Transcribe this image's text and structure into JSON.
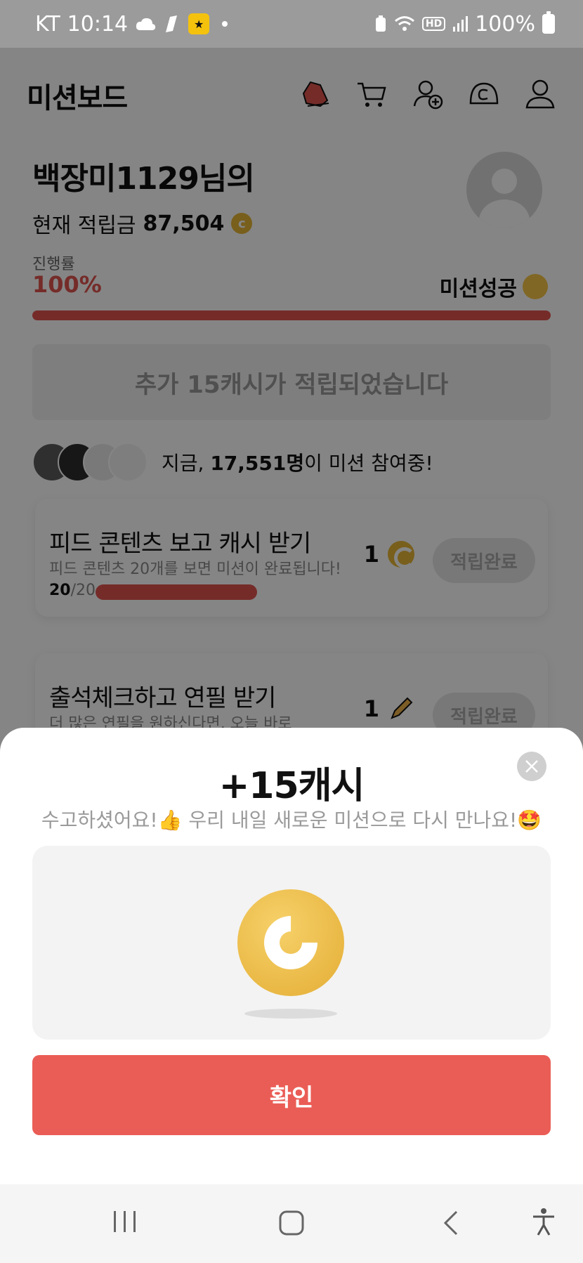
{
  "status_bar": {
    "carrier": "KT",
    "time": "10:14",
    "hd_label": "HD",
    "battery": "100%"
  },
  "header": {
    "title": "미션보드",
    "icons": [
      "shoe-icon",
      "cart-icon",
      "add-friend-icon",
      "cash-icon",
      "profile-icon"
    ]
  },
  "user": {
    "name": "백장미1129님의",
    "balance_label": "현재 적립금",
    "balance": "87,504",
    "coin_glyph": "c"
  },
  "progress": {
    "label": "진행률",
    "value": "100%",
    "status": "미션성공",
    "fraction": 1.0
  },
  "notice": "추가 15캐시가 적립되었습니다",
  "participants": {
    "prefix": "지금, ",
    "count": "17,551명",
    "suffix": "이 미션 참여중!"
  },
  "missions": [
    {
      "title": "피드 콘텐츠 보고 캐시 받기",
      "desc": "피드 콘텐츠 20개를 보면 미션이 완료됩니다!",
      "done": "20",
      "total": "/20",
      "reward": "1",
      "button": "적립완료"
    },
    {
      "title": "출석체크하고 연필 받기",
      "desc": "더 많은 연필을 원하신다면, 오늘 바로",
      "reward": "1",
      "button": "적립완료"
    }
  ],
  "sheet": {
    "title": "+15캐시",
    "message": "수고하셨어요!👍 우리 내일 새로운 미션으로 다시 만나요!🤩",
    "confirm": "확인"
  },
  "colors": {
    "accent": "#ea5d56",
    "coin": "#e6b637",
    "progress": "#e0554f"
  }
}
